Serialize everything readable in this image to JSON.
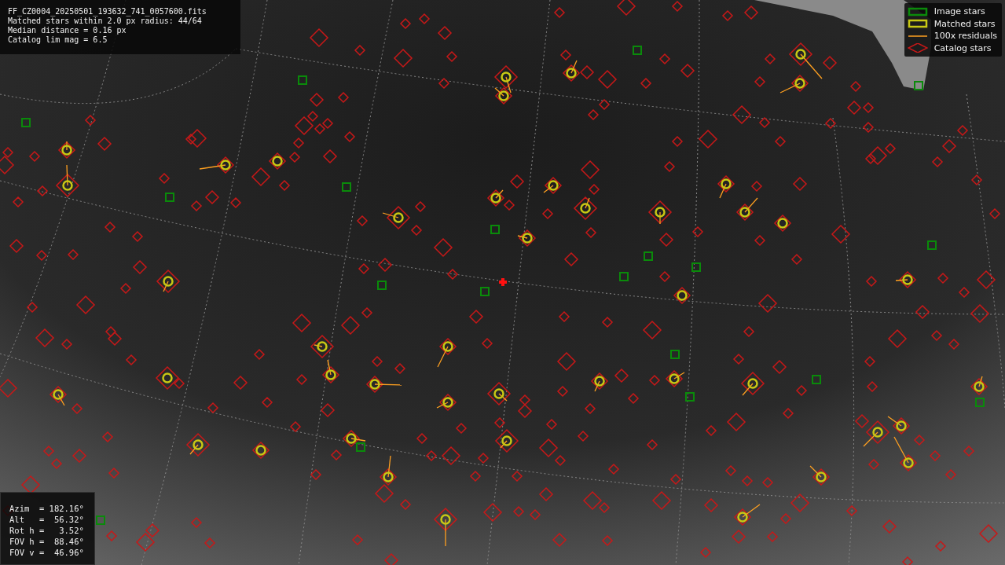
{
  "file_info": [
    "FF_CZ0004_20250501_193632_741_0057600.fits",
    "Matched stars within 2.0 px radius: 44/64",
    "Median distance = 0.16 px",
    "Catalog lim mag = 6.5"
  ],
  "legend": [
    {
      "kind": "image",
      "label": "Image stars"
    },
    {
      "kind": "matched",
      "label": "Matched stars"
    },
    {
      "kind": "residual",
      "label": "100x residuals"
    },
    {
      "kind": "catalog",
      "label": "Catalog stars"
    }
  ],
  "pointing": [
    "Azim  = 182.16°",
    "Alt   =  56.32°",
    "Rot h =   3.52°",
    "FOV h =  88.46°",
    "FOV v =  46.96°"
  ]
}
